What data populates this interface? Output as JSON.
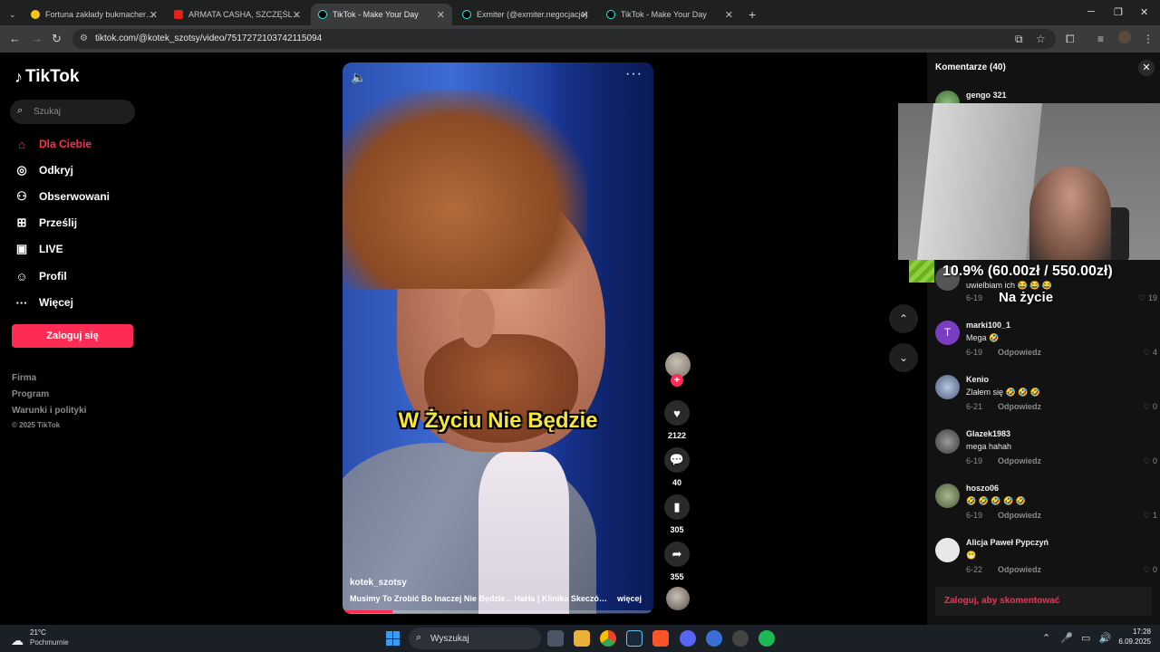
{
  "browser": {
    "tabs": [
      {
        "title": "Fortuna zakłady bukmacherskie"
      },
      {
        "title": "ARMATA CASHA, SZCZĘŚLIWY"
      },
      {
        "title": "TikTok - Make Your Day"
      },
      {
        "title": "Exmiter (@exmiter.negocjacje)"
      },
      {
        "title": "TikTok - Make Your Day"
      }
    ],
    "url": "tiktok.com/@kotek_szotsy/video/7517272103742115094"
  },
  "sidebar": {
    "logo": "TikTok",
    "search_placeholder": "Szukaj",
    "nav": [
      {
        "label": "Dla Ciebie",
        "icon": "home-icon"
      },
      {
        "label": "Odkryj",
        "icon": "compass-icon"
      },
      {
        "label": "Obserwowani",
        "icon": "following-icon"
      },
      {
        "label": "Prześlij",
        "icon": "upload-icon"
      },
      {
        "label": "LIVE",
        "icon": "live-icon"
      },
      {
        "label": "Profil",
        "icon": "profile-icon"
      },
      {
        "label": "Więcej",
        "icon": "more-icon"
      }
    ],
    "login_button": "Zaloguj się",
    "footer": [
      "Firma",
      "Program",
      "Warunki i polityki"
    ],
    "copyright": "© 2025 TikTok"
  },
  "video": {
    "subtitle": "W Życiu Nie Będzie",
    "author": "kotek_szotsy",
    "description": "Musimy To Zrobić Bo Inaczej Nie Będzie... HaHa | Klinika Skeczów ...",
    "more": "więcej",
    "progress": 0.16,
    "likes": "2122",
    "comments": "40",
    "saves": "305",
    "shares": "355"
  },
  "comments_panel": {
    "title": "Komentarze (40)",
    "partial_top_name": "gengo 321",
    "partial_text": "uwielbiam ich 😂 😂 😂",
    "partial_date": "6-19",
    "partial_likes": "19",
    "reply_label": "Odpowiedz",
    "items": [
      {
        "name": "marki100_1",
        "text": "Mega 🤣",
        "date": "6-19",
        "likes": "4"
      },
      {
        "name": "Kenio",
        "text": "Zlałem się 🤣 🤣 🤣",
        "date": "6-21",
        "likes": "0"
      },
      {
        "name": "Glazek1983",
        "text": "mega hahah",
        "date": "6-19",
        "likes": "0"
      },
      {
        "name": "hoszo06",
        "text": "🤣 🤣 🤣 🤣 🤣",
        "date": "6-19",
        "likes": "1"
      },
      {
        "name": "Alicja Paweł Pypczyń",
        "text": "😁",
        "date": "6-22",
        "likes": "0"
      }
    ],
    "login_prompt": "Zaloguj, aby skomentować"
  },
  "overlay": {
    "donation": "10.9% (60.00zł / 550.00zł)",
    "donation_sub": "Na życie"
  },
  "taskbar": {
    "temperature": "21°C",
    "weather": "Pochmurnie",
    "search": "Wyszukaj",
    "time": "17:28",
    "date": "6.09.2025"
  },
  "colors": {
    "accent": "#fe2c55",
    "subtitle": "#f6e53a"
  }
}
